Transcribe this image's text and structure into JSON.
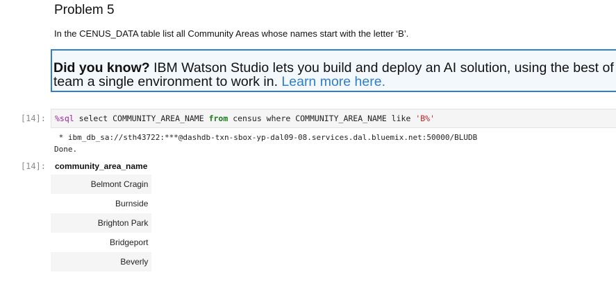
{
  "markdown": {
    "heading": "Problem 5",
    "paragraph": "In the CENUS_DATA table list all Community Areas whose names start with the letter ‘B’."
  },
  "info_box": {
    "bold": "Did you know?",
    "text_line1": " IBM Watson Studio lets you build and deploy an AI solution, using the best of open source and IBM software and giving your",
    "text_line2": "team a single environment to work in. ",
    "link": "Learn more here."
  },
  "code_cell": {
    "prompt": "[14]:",
    "magic": "%sql",
    "seg1": " select COMMUNITY_AREA_NAME ",
    "keyword": "from",
    "seg2": " census where COMMUNITY_AREA_NAME like ",
    "string": "'B%'"
  },
  "output": {
    "connection": " * ibm_db_sa://sth43722:***@dashdb-txn-sbox-yp-dal09-08.services.dal.bluemix.net:50000/BLUDB",
    "status": "Done.",
    "prompt": "[14]:",
    "table": {
      "header": "community_area_name",
      "rows": [
        "Belmont Cragin",
        "Burnside",
        "Brighton Park",
        "Bridgeport",
        "Beverly"
      ]
    }
  },
  "colors": {
    "accent_blue": "#2f7ec9",
    "prompt_gray": "#8a8a8a",
    "keyword_green": "#1a7f1a",
    "string_red": "#ba2121",
    "magic_purple": "#a020a0"
  }
}
